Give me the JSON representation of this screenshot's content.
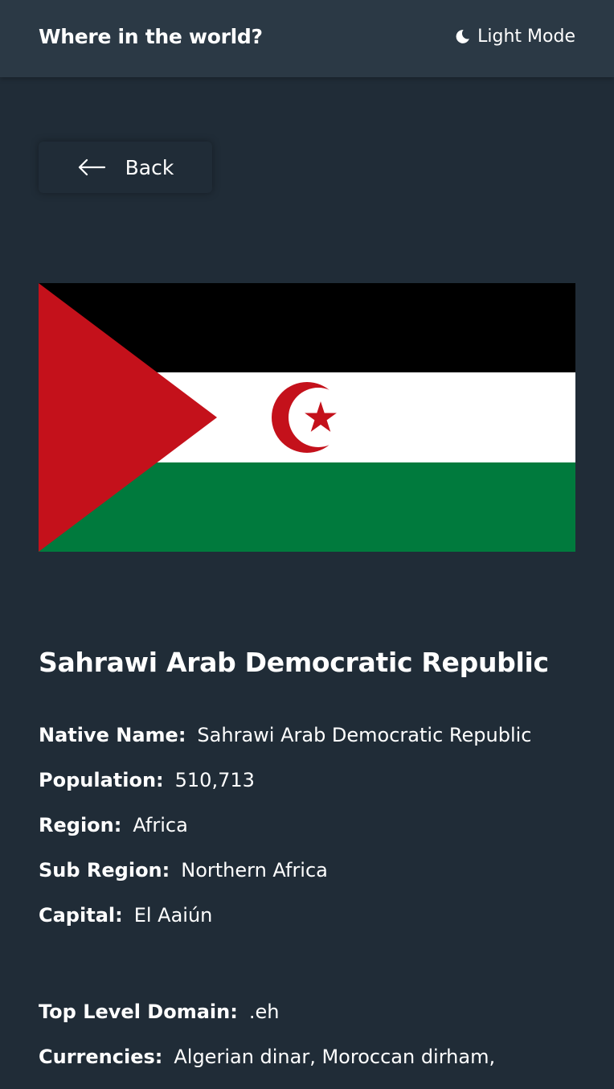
{
  "header": {
    "title": "Where in the world?",
    "theme_toggle_label": "Light Mode",
    "theme_icon": "moon-icon"
  },
  "back_button": {
    "label": "Back",
    "icon": "arrow-left-icon"
  },
  "flag": {
    "icon": "flag-of-western-sahara",
    "colors": {
      "black": "#000000",
      "white": "#ffffff",
      "green": "#007a3d",
      "red": "#c4111b"
    }
  },
  "country": {
    "name": "Sahrawi Arab Democratic Republic",
    "details": [
      {
        "label": "Native Name:",
        "value": "Sahrawi Arab Democratic Republic"
      },
      {
        "label": "Population:",
        "value": "510,713"
      },
      {
        "label": "Region:",
        "value": "Africa"
      },
      {
        "label": "Sub Region:",
        "value": "Northern Africa"
      },
      {
        "label": "Capital:",
        "value": "El Aaiún"
      }
    ],
    "extra": [
      {
        "label": "Top Level Domain:",
        "value": ".eh"
      },
      {
        "label": "Currencies:",
        "value": "Algerian dinar, Moroccan dirham,"
      }
    ]
  },
  "colors": {
    "background": "#202c37",
    "element": "#2b3945",
    "text": "#ffffff"
  }
}
